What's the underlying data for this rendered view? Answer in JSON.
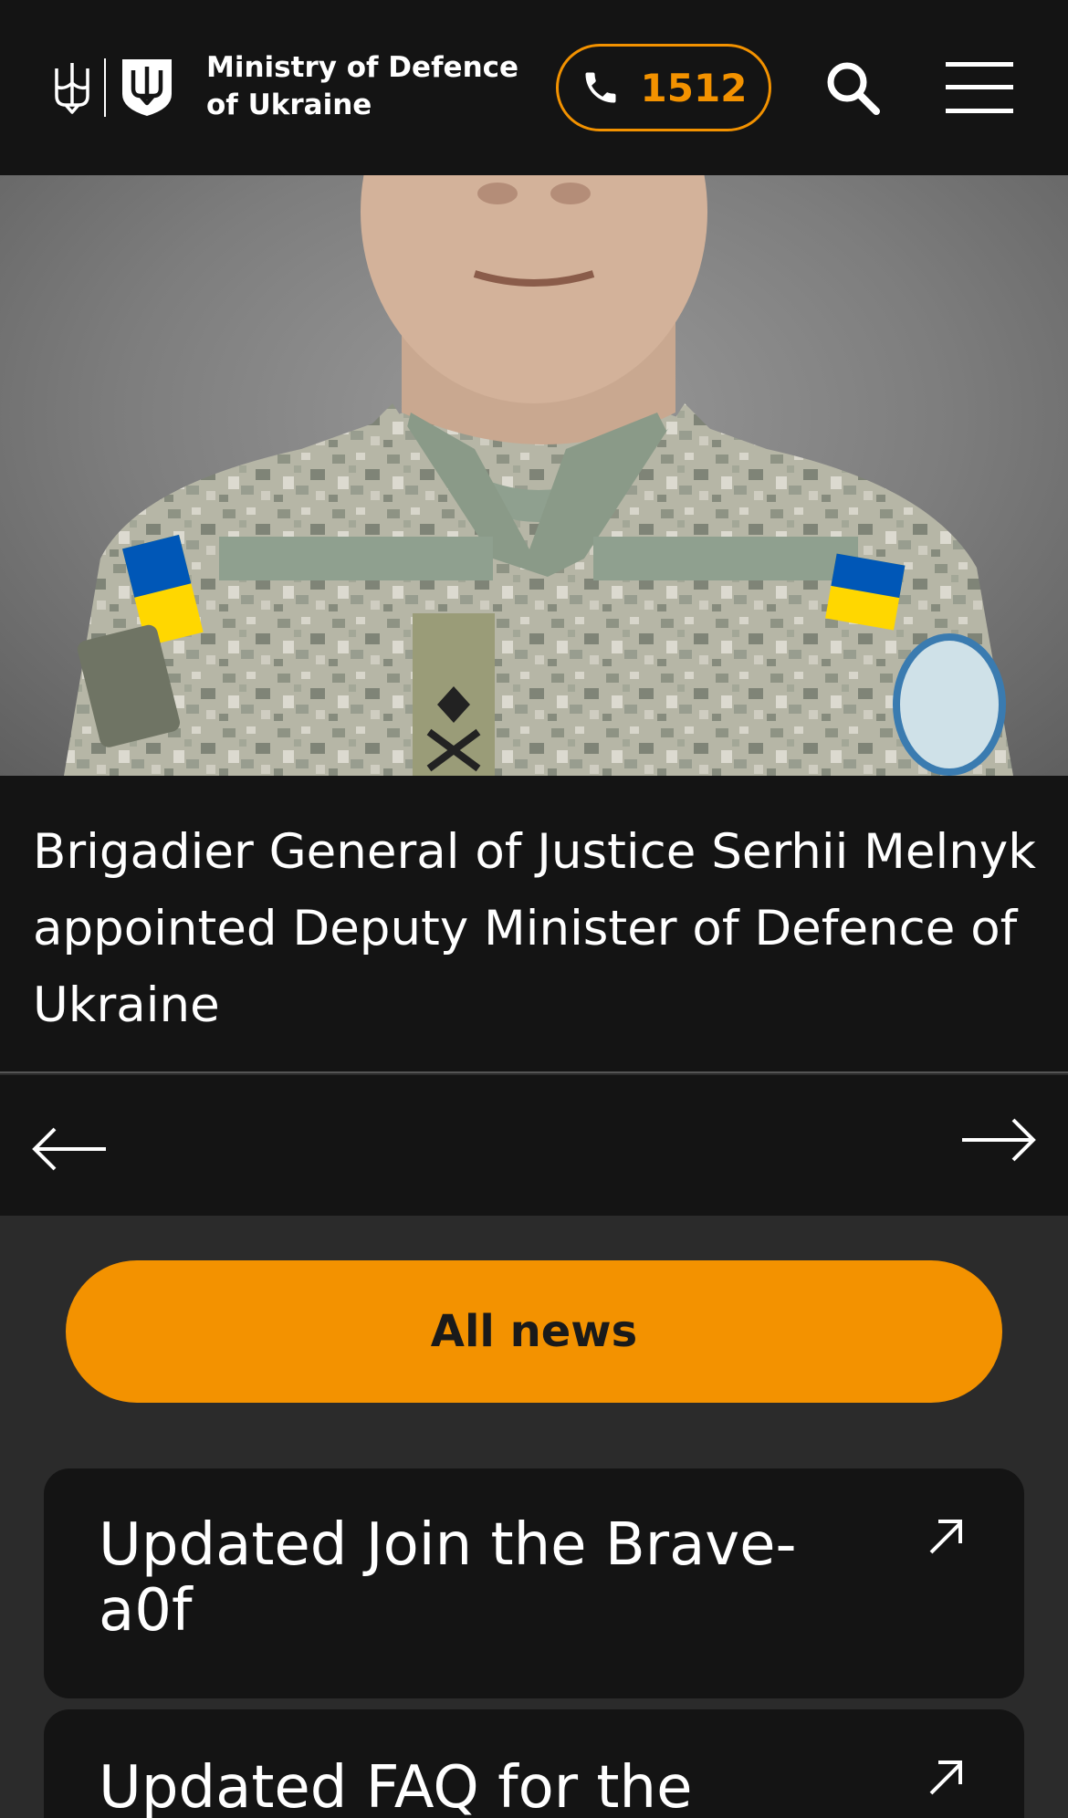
{
  "header": {
    "logo_line1": "Ministry of Defence",
    "logo_line2": "of Ukraine",
    "phone_number": "1512",
    "accent_color": "#f39200",
    "icons": [
      "trident-icon",
      "shield-emblem-icon",
      "phone-icon",
      "search-icon",
      "hamburger-menu-icon"
    ]
  },
  "hero": {
    "caption": "Brigadier General of Justice Serhii Melnyk appointed Deputy Minister of Defence of Ukraine"
  },
  "slider": {
    "prev_icon": "arrow-left-icon",
    "next_icon": "arrow-right-icon"
  },
  "all_news_label": "All news",
  "links": [
    {
      "title": "Updated Join the Brave-a0f",
      "icon": "external-link-icon"
    },
    {
      "title": "Updated FAQ for the",
      "icon": "external-link-icon"
    }
  ]
}
